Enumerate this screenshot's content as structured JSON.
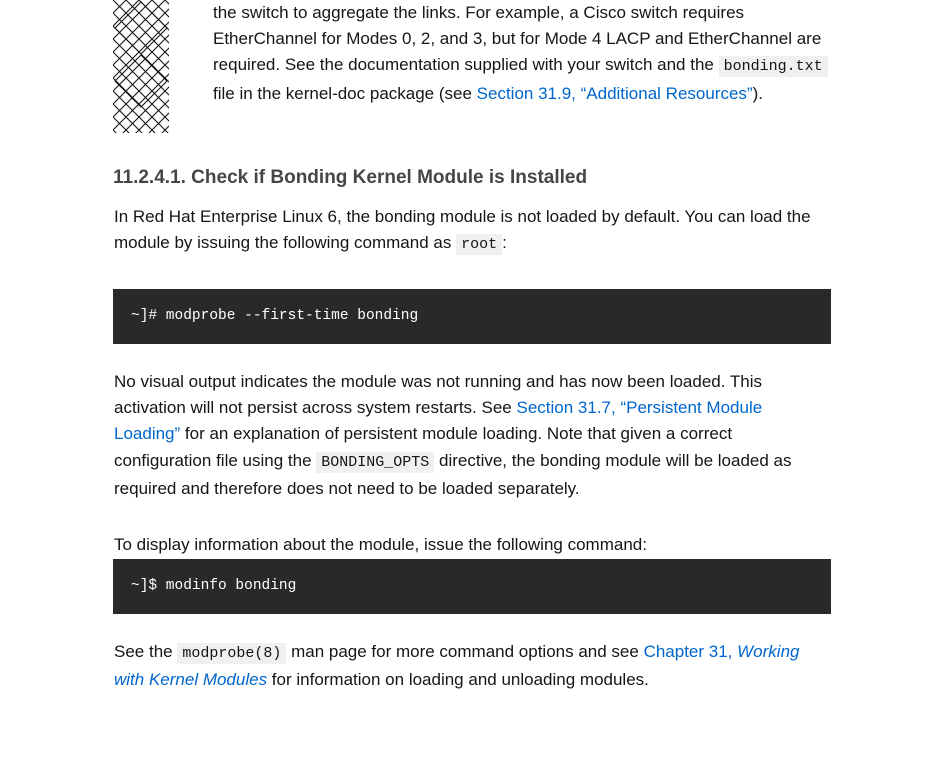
{
  "admonition": {
    "icon": "warning-crosshatch-icon",
    "line1": "the switch to aggregate the links. For example, a Cisco switch requires EtherChannel for Modes 0, 2, and 3, but for Mode 4 LACP and EtherChannel are required. See the documentation supplied with your switch and the",
    "code": "bonding.txt",
    "mid": " file in the kernel-doc package (see ",
    "link": "Section 31.9, “Additional Resources”",
    "end": ")."
  },
  "heading": "11.2.4.1. Check if Bonding Kernel Module is Installed",
  "para1": {
    "text": "In Red Hat Enterprise Linux 6, the bonding module is not loaded by default. You can load the module by issuing the following command as ",
    "code": "root",
    "end": ":"
  },
  "code1": "~]# modprobe --first-time bonding",
  "para2": {
    "text1": "No visual output indicates the module was not running and has now been loaded. This activation will not persist across system restarts. See ",
    "link": "Section 31.7, “Persistent Module Loading”",
    "text2": " for an explanation of persistent module loading. Note that given a correct configuration file using the ",
    "code": "BONDING_OPTS",
    "text3": " directive, the bonding module will be loaded as required and therefore does not need to be loaded separately."
  },
  "para3": "To display information about the module, issue the following command:",
  "code2": "~]$ modinfo bonding",
  "para4": {
    "text1": "See the ",
    "code": "modprobe(8)",
    "text2": " man page for more command options and see ",
    "link_plain": "Chapter 31, ",
    "link_em": "Working with Kernel Modules",
    "text3": " for information on loading and unloading modules."
  },
  "colors": {
    "link": "#0066cc",
    "code_bg": "#292929",
    "inline_code_bg": "#f0f0f0",
    "heading": "#464646"
  }
}
